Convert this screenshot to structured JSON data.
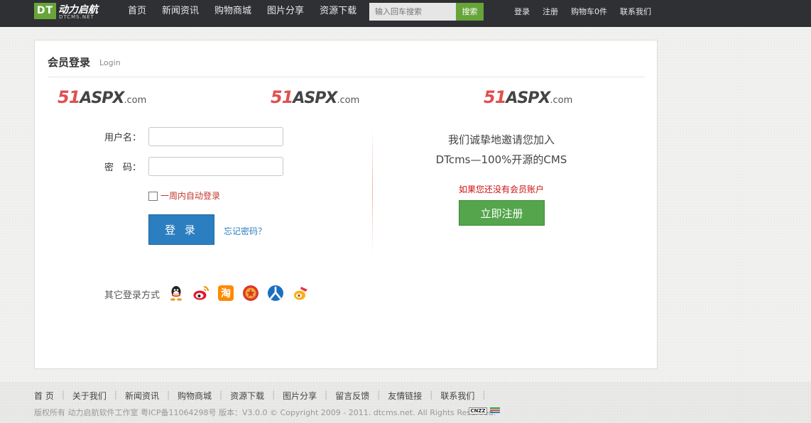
{
  "header": {
    "logo_mark": "DT",
    "logo_cn": "动力启航",
    "logo_en": "DTCMS.NET",
    "nav": [
      "首页",
      "新闻资讯",
      "购物商城",
      "图片分享",
      "资源下载"
    ],
    "search_placeholder": "输入回车搜索",
    "search_button": "搜索",
    "links": [
      "登录",
      "注册",
      "购物车0件",
      "联系我们"
    ]
  },
  "login": {
    "title": "会员登录",
    "subtitle": "Login",
    "watermark": {
      "num": "51",
      "asp": "ASPX",
      "com": ".com"
    },
    "username_label": "用户名：",
    "password_label": "密　码：",
    "remember_label": "一周内自动登录",
    "remember_checked": false,
    "login_button": "登 录",
    "forgot_link": "忘记密码？",
    "other_label": "其它登录方式",
    "other_providers": [
      "qq-icon",
      "weibo-icon",
      "taobao-icon",
      "renren-icon",
      "kaixin-icon",
      "douban-icon"
    ]
  },
  "register": {
    "invite_line1": "我们诚挚地邀请您加入",
    "invite_line2": "DTcms—100%开源的CMS",
    "no_account": "如果您还没有会员账户",
    "register_button": "立即注册"
  },
  "footer": {
    "links": [
      "首 页",
      "关于我们",
      "新闻资讯",
      "购物商城",
      "资源下载",
      "图片分享",
      "留言反馈",
      "友情链接",
      "联系我们"
    ],
    "copyright": "版权所有 动力启航软件工作室 粤ICP备11064298号 版本：V3.0.0 © Copyright 2009 - 2011. dtcms.net. All Rights Reserved.",
    "stat_badge": "CNZZ"
  },
  "colors": {
    "topbar": "#2f3033",
    "brand_green": "#67a53a",
    "login_blue": "#2b7ec0",
    "register_green": "#54a54c",
    "alert_red": "#cc1111"
  }
}
